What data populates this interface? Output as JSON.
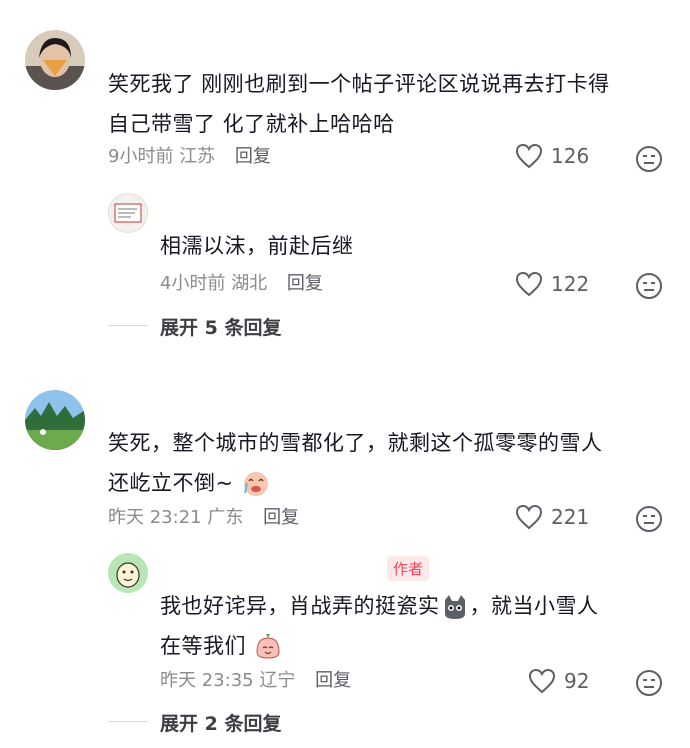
{
  "comments": [
    {
      "text_line1": "笑死我了 刚刚也刷到一个帖子评论区说说再去打卡得",
      "text_line2": "自己带雪了 化了就补上哈哈哈",
      "time": "9小时前",
      "location": "江苏",
      "reply_label": "回复",
      "likes": "126",
      "reply": {
        "text": "相濡以沫，前赴后继",
        "time": "4小时前",
        "location": "湖北",
        "reply_label": "回复",
        "likes": "122"
      },
      "expand_label": "展开 5 条回复"
    },
    {
      "text_line1": "笑死，整个城市的雪都化了，就剩这个孤零零的雪人",
      "text_line2": "还屹立不倒~",
      "time": "昨天 23:21",
      "location": "广东",
      "reply_label": "回复",
      "likes": "221",
      "reply": {
        "author_badge": "作者",
        "text_line1_a": "我也好诧异，肖战弄的挺瓷实",
        "text_line1_b": "，就当小雪人",
        "text_line2": "在等我们",
        "time": "昨天 23:35",
        "location": "辽宁",
        "reply_label": "回复",
        "likes": "92"
      },
      "expand_label": "展开 2 条回复"
    }
  ],
  "icons": {
    "like": "heart-outline-icon",
    "dislike": "dislike-face-icon",
    "emoji_crying": "crying-laughing-face-emoji",
    "emoji_cat": "gray-cat-emoji",
    "emoji_bun": "smiling-bun-emoji"
  },
  "colors": {
    "text": "#161823",
    "meta": "#8a8b91",
    "author_badge_bg": "#fde8ea",
    "author_badge_text": "#f0475a"
  }
}
